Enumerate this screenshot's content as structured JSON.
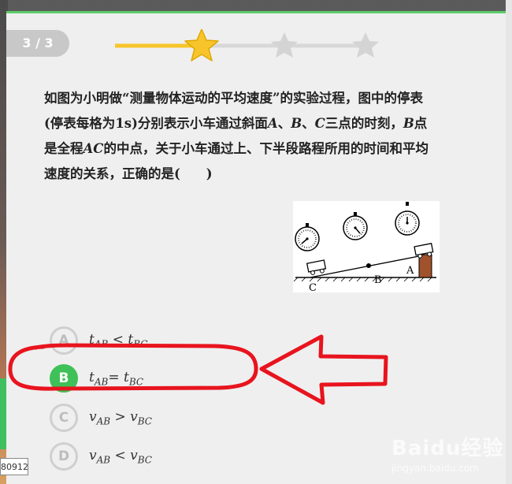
{
  "header": {
    "progress_label": "3 / 3"
  },
  "question": {
    "line1": "如图为小明做“测量物体运动的平均速度”的实验过程，图中的停表",
    "line2_a": "(停表每格为",
    "line2_unit": "1s",
    "line2_b": ")分别表示小车通过斜面",
    "line2_A": "A",
    "line2_sep1": "、",
    "line2_B": "B",
    "line2_sep2": "、",
    "line2_C": "C",
    "line2_c": "三点的时刻，",
    "line2_B2": "B",
    "line2_d": "点",
    "line3_a": "是全程",
    "line3_AC": "AC",
    "line3_b": "的中点，关于小车通过上、下半段路程所用的时间和平均",
    "line4": "速度的关系，正确的是(　　)"
  },
  "figure": {
    "label_A": "A",
    "label_B": "B",
    "label_C": "C"
  },
  "options": [
    {
      "letter": "A",
      "left": "t",
      "left_sub": "AB",
      "op": " < ",
      "right": "t",
      "right_sub": "BC",
      "selected": false
    },
    {
      "letter": "B",
      "left": "t",
      "left_sub": "AB",
      "op": "= ",
      "right": "t",
      "right_sub": "BC",
      "selected": true
    },
    {
      "letter": "C",
      "left": "v",
      "left_sub": "AB",
      "op": " > ",
      "right": "v",
      "right_sub": "BC",
      "selected": false
    },
    {
      "letter": "D",
      "left": "v",
      "left_sub": "AB",
      "op": " < ",
      "right": "v",
      "right_sub": "BC",
      "selected": false
    }
  ],
  "stamp": {
    "text": "80912"
  },
  "watermark": {
    "brand": "Baidu经验",
    "url": "jingyan.baidu.com"
  },
  "colors": {
    "accent_green": "#3ec158",
    "star_active": "#f7c52b",
    "annotation_red": "#e8141e"
  }
}
